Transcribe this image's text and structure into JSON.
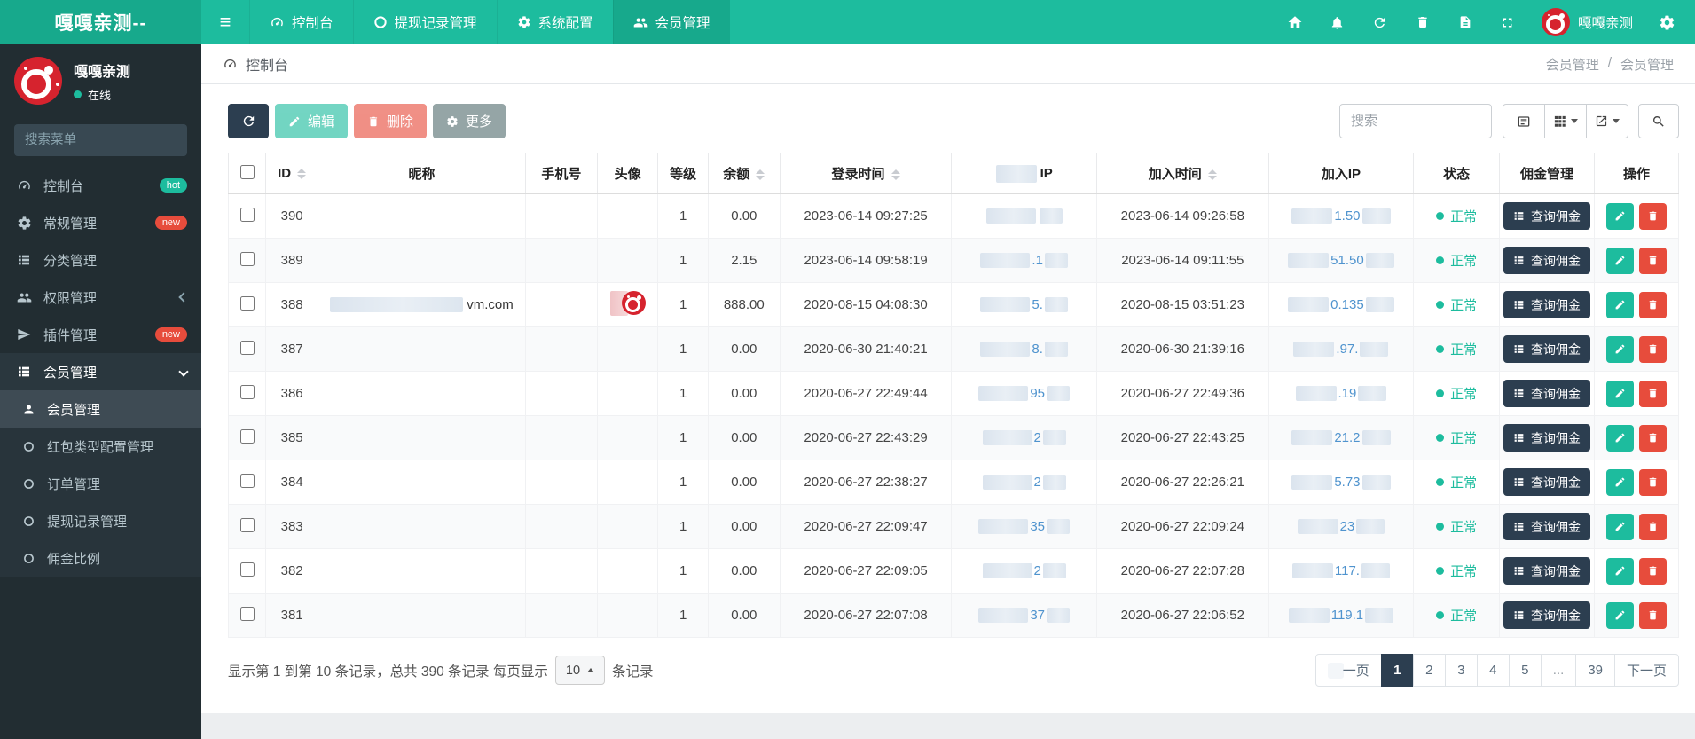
{
  "colors": {
    "accent": "#1dbc9e",
    "navy": "#2c3e50",
    "danger": "#e74c3c",
    "sidebar_bg": "#222d32",
    "link_blue": "#4f93ce"
  },
  "icons": [
    "menu-icon",
    "dashboard-icon",
    "circle-icon",
    "gear-icon",
    "users-icon",
    "home-icon",
    "bell-icon",
    "refresh-icon",
    "trash-icon",
    "file-icon",
    "expand-icon",
    "cogs-icon",
    "search-icon",
    "list-icon",
    "rocket-icon",
    "person-icon",
    "pencil-icon",
    "grid-icon",
    "export-icon",
    "detail-list-icon",
    "sort-icon",
    "caret-icon"
  ],
  "navbar": {
    "brand": "嘎嘎亲测--",
    "menu": [
      {
        "label": "控制台"
      },
      {
        "label": "提现记录管理"
      },
      {
        "label": "系统配置"
      },
      {
        "label": "会员管理"
      }
    ],
    "username": "嘎嘎亲测"
  },
  "sidebar": {
    "user_name": "嘎嘎亲测",
    "user_status": "在线",
    "search_placeholder": "搜索菜单",
    "menu": [
      {
        "label": "控制台",
        "badge": "hot"
      },
      {
        "label": "常规管理",
        "badge": "new"
      },
      {
        "label": "分类管理"
      },
      {
        "label": "权限管理"
      },
      {
        "label": "插件管理",
        "badge": "new"
      },
      {
        "label": "会员管理"
      }
    ],
    "submenu": [
      {
        "label": "会员管理"
      },
      {
        "label": "红包类型配置管理"
      },
      {
        "label": "订单管理"
      },
      {
        "label": "提现记录管理"
      },
      {
        "label": "佣金比例"
      }
    ]
  },
  "breadcrumb": {
    "page": "控制台",
    "right_parent": "会员管理",
    "right_sep": "/",
    "right_current": "会员管理"
  },
  "toolbar": {
    "edit_label": "编辑",
    "delete_label": "删除",
    "more_label": "更多",
    "search_placeholder": "搜索"
  },
  "table": {
    "headers": {
      "id": "ID",
      "nickname": "昵称",
      "phone": "手机号",
      "avatar": "头像",
      "level": "等级",
      "balance": "余额",
      "login_time": "登录时间",
      "login_ip": "IP",
      "join_time": "加入时间",
      "join_ip": "加入IP",
      "status": "状态",
      "commission": "佣金管理",
      "ops": "操作"
    },
    "commission_label": "查询佣金",
    "rows": [
      {
        "id": "390",
        "nick_frag": "",
        "level": "1",
        "balance": "0.00",
        "login_time": "2023-06-14 09:27:25",
        "login_ip_frag": "",
        "join_time": "2023-06-14 09:26:58",
        "join_ip_frag": "1.50",
        "status": "正常"
      },
      {
        "id": "389",
        "nick_frag": "",
        "level": "1",
        "balance": "2.15",
        "login_time": "2023-06-14 09:58:19",
        "login_ip_frag": ".1",
        "join_time": "2023-06-14 09:11:55",
        "join_ip_frag": "51.50",
        "status": "正常"
      },
      {
        "id": "388",
        "nick_blur": true,
        "nick_frag": "vm.com",
        "avatar": true,
        "level": "1",
        "balance": "888.00",
        "login_time": "2020-08-15 04:08:30",
        "login_ip_frag": "5.",
        "join_time": "2020-08-15 03:51:23",
        "join_ip_frag": "0.135",
        "status": "正常"
      },
      {
        "id": "387",
        "nick_frag": "",
        "level": "1",
        "balance": "0.00",
        "login_time": "2020-06-30 21:40:21",
        "login_ip_frag": "8.",
        "join_time": "2020-06-30 21:39:16",
        "join_ip_frag": ".97.",
        "status": "正常"
      },
      {
        "id": "386",
        "nick_frag": "",
        "level": "1",
        "balance": "0.00",
        "login_time": "2020-06-27 22:49:44",
        "login_ip_frag": "95",
        "join_time": "2020-06-27 22:49:36",
        "join_ip_frag": ".19",
        "status": "正常"
      },
      {
        "id": "385",
        "nick_frag": "",
        "level": "1",
        "balance": "0.00",
        "login_time": "2020-06-27 22:43:29",
        "login_ip_frag": "2",
        "join_time": "2020-06-27 22:43:25",
        "join_ip_frag": "21.2",
        "status": "正常"
      },
      {
        "id": "384",
        "nick_frag": "",
        "level": "1",
        "balance": "0.00",
        "login_time": "2020-06-27 22:38:27",
        "login_ip_frag": "2",
        "join_time": "2020-06-27 22:26:21",
        "join_ip_frag": "5.73",
        "status": "正常"
      },
      {
        "id": "383",
        "nick_frag": "",
        "level": "1",
        "balance": "0.00",
        "login_time": "2020-06-27 22:09:47",
        "login_ip_frag": "35",
        "join_time": "2020-06-27 22:09:24",
        "join_ip_frag": "23",
        "status": "正常"
      },
      {
        "id": "382",
        "nick_frag": "",
        "level": "1",
        "balance": "0.00",
        "login_time": "2020-06-27 22:09:05",
        "login_ip_frag": "2",
        "join_time": "2020-06-27 22:07:28",
        "join_ip_frag": "117.",
        "status": "正常"
      },
      {
        "id": "381",
        "nick_frag": "",
        "level": "1",
        "balance": "0.00",
        "login_time": "2020-06-27 22:07:08",
        "login_ip_frag": "37",
        "join_time": "2020-06-27 22:06:52",
        "join_ip_frag": "119.1",
        "status": "正常"
      }
    ]
  },
  "footer": {
    "info_prefix": "显示第 1 到第 10 条记录，总共 390 条记录 每页显示",
    "page_size": "10",
    "info_suffix": "条记录",
    "prev_visible": "一页",
    "next_label": "下一页",
    "pages": [
      "1",
      "2",
      "3",
      "4",
      "5",
      "...",
      "39"
    ]
  }
}
